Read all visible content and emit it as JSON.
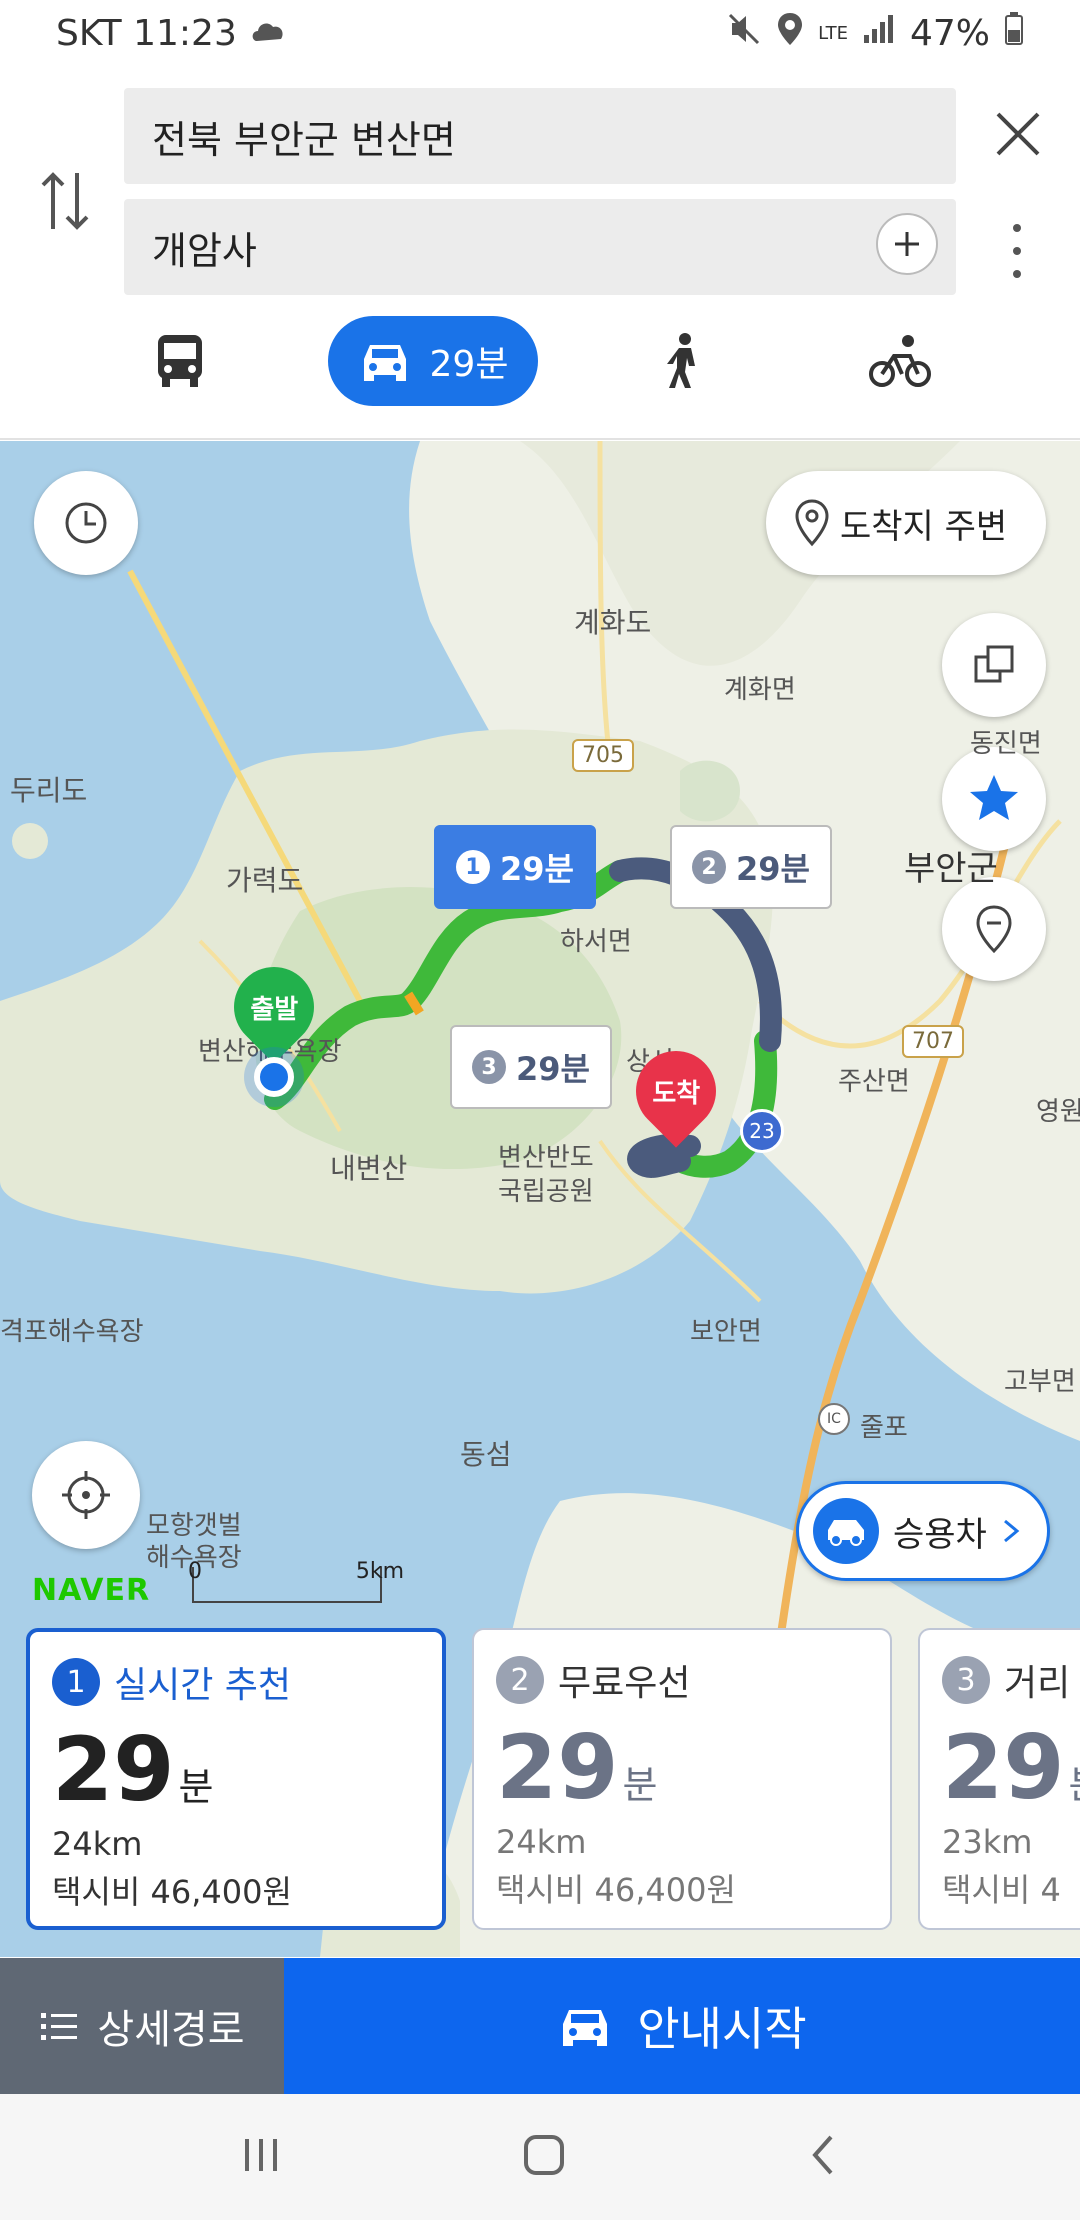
{
  "status": {
    "carrier_time": "SKT 11:23",
    "network": "LTE",
    "battery": "47%"
  },
  "search": {
    "origin": "전북 부안군 변산면",
    "destination": "개암사",
    "add_icon": "plus-icon",
    "close_icon": "close-icon"
  },
  "modes": {
    "car_time": "29분",
    "items": [
      "bus-icon",
      "car-icon",
      "walk-icon",
      "bike-icon"
    ]
  },
  "map": {
    "nearby_button": "도착지 주변",
    "start_label": "출발",
    "end_label": "도착",
    "vehicle_button": "승용차",
    "naver_logo": "NAVER",
    "scale_start": "0",
    "scale_end": "5km",
    "callouts": [
      {
        "num": "1",
        "time": "29분"
      },
      {
        "num": "2",
        "time": "29분"
      },
      {
        "num": "3",
        "time": "29분"
      }
    ],
    "places": {
      "gyehwado": "계화도",
      "gyehwamyeon": "계화면",
      "dongjinmyeon": "동진면",
      "durido": "두리도",
      "garyeokdo": "가력도",
      "buangun": "부안군",
      "haseomyeon": "하서면",
      "byeonsan_beach": "변산해수욕장",
      "byeonsan": "변산",
      "sangseo": "상서",
      "jusanmyeon": "주산면",
      "yeongwon": "영원",
      "naebyeonsan": "내변산",
      "park_line1": "변산반도",
      "park_line2": "국립공원",
      "gyeokpo": "격포해수욕장",
      "boanmyeon": "보안면",
      "gobu": "고부면",
      "julpo": "줄포",
      "dongseom": "동섬",
      "mohang_line1": "모항갯벌",
      "mohang_line2": "해수욕장",
      "road_705": "705",
      "road_707": "707",
      "road_23": "23",
      "ic": "IC"
    }
  },
  "routes": [
    {
      "num": "1",
      "title": "실시간 추천",
      "time": "29",
      "unit": "분",
      "distance": "24km",
      "taxi": "택시비 46,400원"
    },
    {
      "num": "2",
      "title": "무료우선",
      "time": "29",
      "unit": "분",
      "distance": "24km",
      "taxi": "택시비 46,400원"
    },
    {
      "num": "3",
      "title": "거리",
      "time": "29",
      "unit": "분",
      "distance": "23km",
      "taxi": "택시비 4"
    }
  ],
  "actions": {
    "detail": "상세경로",
    "start": "안내시작"
  },
  "colors": {
    "primary": "#0d66ee",
    "route_green": "#3fb93a",
    "route_navy": "#4b5b7d",
    "dest_red": "#e8334a",
    "start_green": "#22b14c"
  }
}
